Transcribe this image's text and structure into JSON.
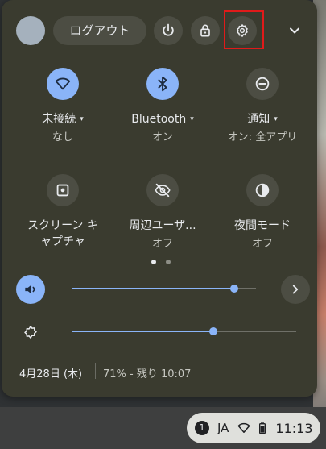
{
  "header": {
    "logout_label": "ログアウト"
  },
  "tiles": [
    {
      "label": "未接続",
      "caret": "▾",
      "sub": "なし",
      "icon": "wifi-icon",
      "active": true
    },
    {
      "label": "Bluetooth",
      "caret": "▾",
      "sub": "オン",
      "icon": "bluetooth-icon",
      "active": true
    },
    {
      "label": "通知",
      "caret": "▾",
      "sub": "オン: 全アプリ",
      "icon": "do-not-disturb-icon",
      "active": false
    },
    {
      "label": "スクリーン キ\nャプチャ",
      "caret": "",
      "sub": "",
      "icon": "screen-capture-icon",
      "active": false
    },
    {
      "label": "周辺ユーザ...",
      "caret": "",
      "sub": "オフ",
      "icon": "privacy-screen-icon",
      "active": false
    },
    {
      "label": "夜間モード",
      "caret": "",
      "sub": "オフ",
      "icon": "night-light-icon",
      "active": false
    }
  ],
  "sliders": {
    "volume_level": 0.88,
    "brightness_level": 0.63
  },
  "footer": {
    "date": "4月28日 (木)",
    "battery": "71% - 残り 10:07"
  },
  "shelf": {
    "notification_count": "1",
    "ime": "JA",
    "time": "11:13"
  },
  "colors": {
    "accent": "#8ab4f8",
    "highlight": "#e01a1a"
  }
}
